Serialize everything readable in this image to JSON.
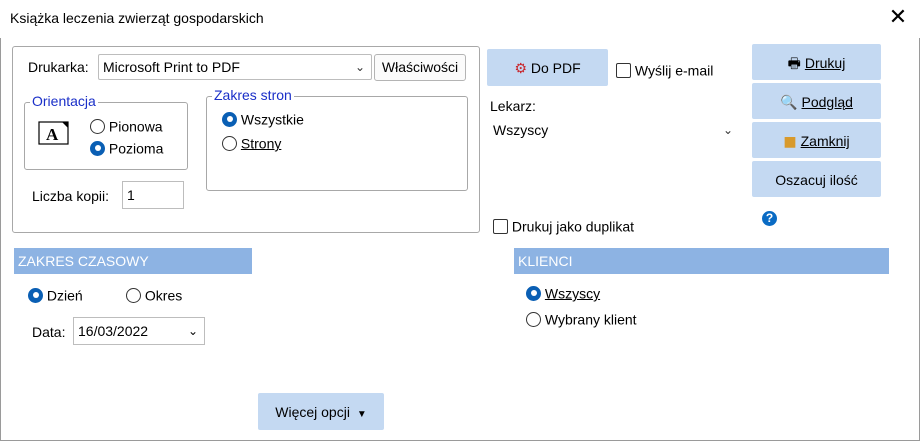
{
  "window": {
    "title": "Książka leczenia zwierząt gospodarskich",
    "close_glyph": "✕"
  },
  "printer": {
    "label": "Drukarka:",
    "value": "Microsoft Print to PDF",
    "properties_label": "Właściwości"
  },
  "orientation": {
    "legend": "Orientacja",
    "options": [
      "Pionowa",
      "Pozioma"
    ],
    "selected": "Pozioma"
  },
  "page_range": {
    "legend": "Zakres stron",
    "options": [
      "Wszystkie",
      "Strony"
    ],
    "selected": "Wszystkie"
  },
  "copies": {
    "label": "Liczba kopii:",
    "value": "1"
  },
  "pdf_button": {
    "label": "Do PDF"
  },
  "send_email": {
    "label": "Wyślij e-mail",
    "checked": false
  },
  "doctor": {
    "label": "Lekarz:",
    "value": "Wszyscy"
  },
  "duplicate": {
    "label": "Drukuj jako duplikat",
    "checked": false
  },
  "actions": {
    "print": "Drukuj",
    "preview": "Podgląd",
    "close": "Zamknij",
    "estimate": "Oszacuj ilość"
  },
  "time_range": {
    "header": "ZAKRES CZASOWY",
    "options": [
      "Dzień",
      "Okres"
    ],
    "selected": "Dzień",
    "date_label": "Data:",
    "date_value": "16/03/2022"
  },
  "clients": {
    "header": "KLIENCI",
    "options": [
      "Wszyscy",
      "Wybrany klient"
    ],
    "selected": "Wszyscy"
  },
  "more_options": {
    "label": "Więcej opcji"
  },
  "colors": {
    "accent": "#0a5fb4",
    "button_blue": "#c4d9f2",
    "header_blue": "#8db3e3",
    "legend_text": "#1a2fc8"
  }
}
